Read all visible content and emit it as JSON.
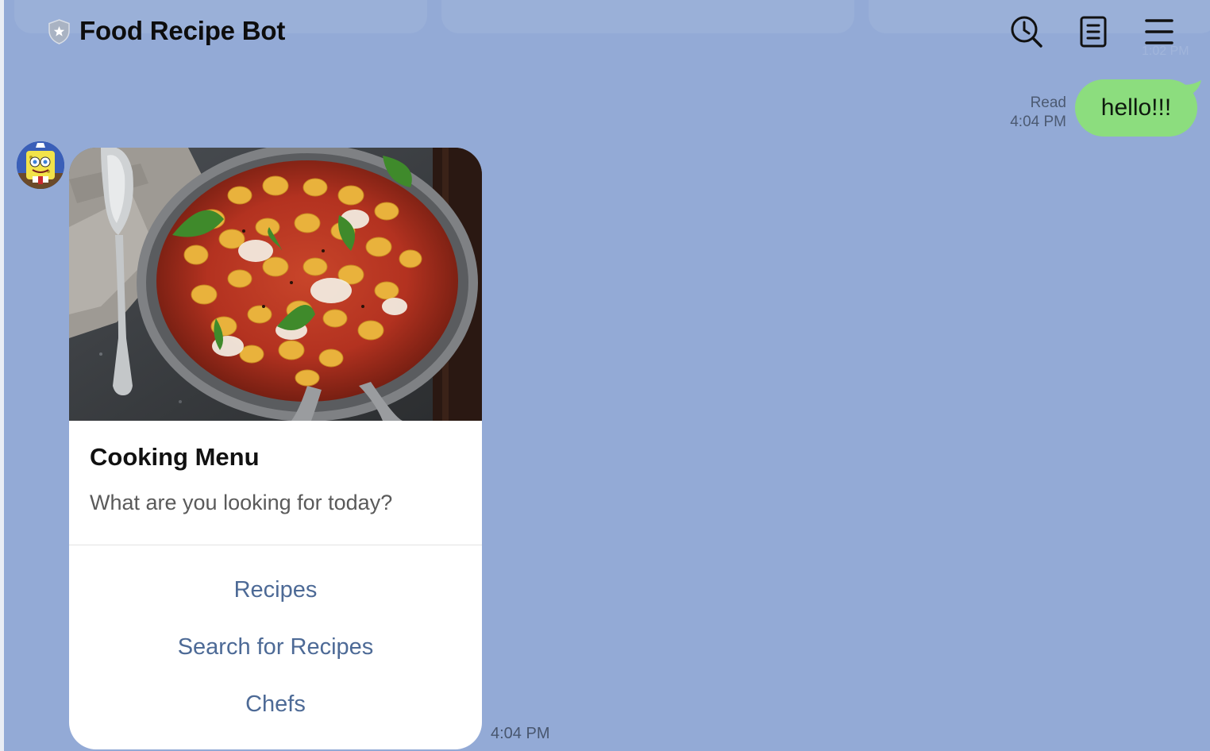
{
  "header": {
    "title": "Food Recipe Bot",
    "icons": {
      "official_badge": "shield-star-icon",
      "search": "search-icon",
      "notes": "notes-icon",
      "menu": "hamburger-menu-icon"
    }
  },
  "messages": {
    "outgoing": {
      "text": "hello!!!",
      "status": "Read",
      "time": "4:04 PM"
    },
    "incoming": {
      "card": {
        "image": "gnocchi-bake-photo",
        "title": "Cooking Menu",
        "description": "What are you looking for today?",
        "actions": [
          "Recipes",
          "Search for Recipes",
          "Chefs"
        ]
      },
      "time": "4:04 PM"
    }
  },
  "colors": {
    "chat_background": "#93aad6",
    "outgoing_bubble": "#8cdd7e",
    "card_background": "#ffffff",
    "action_text": "#4d6a96"
  }
}
